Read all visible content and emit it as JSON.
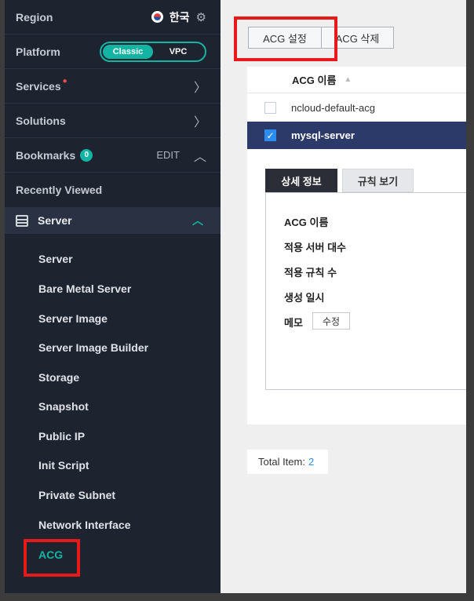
{
  "sidebar": {
    "region_label": "Region",
    "region_value": "한국",
    "platform_label": "Platform",
    "platform_options": [
      "Classic",
      "VPC"
    ],
    "services_label": "Services",
    "solutions_label": "Solutions",
    "bookmarks_label": "Bookmarks",
    "bookmarks_count": "0",
    "bookmarks_edit": "EDIT",
    "recently_viewed_label": "Recently Viewed",
    "server_section": "Server",
    "server_items": [
      "Server",
      "Bare Metal Server",
      "Server Image",
      "Server Image Builder",
      "Storage",
      "Snapshot",
      "Public IP",
      "Init Script",
      "Private Subnet",
      "Network Interface",
      "ACG"
    ],
    "active_item": "ACG"
  },
  "toolbar": {
    "acg_settings": "ACG 설정",
    "acg_delete": "ACG 삭제"
  },
  "table": {
    "column_header": "ACG 이름",
    "rows": [
      {
        "name": "ncloud-default-acg",
        "checked": false
      },
      {
        "name": "mysql-server",
        "checked": true
      }
    ]
  },
  "detail": {
    "tabs": [
      "상세 정보",
      "규칙 보기"
    ],
    "labels": [
      "ACG 이름",
      "적용 서버 대수",
      "적용 규칙 수",
      "생성 일시",
      "메모"
    ],
    "memo_edit": "수정"
  },
  "footer": {
    "total_label": "Total Item:",
    "total_value": "2"
  },
  "colors": {
    "accent": "#13b4a3",
    "selected_row": "#2c3a6a",
    "highlight_box": "#e81919",
    "link_blue": "#2d8cf0"
  }
}
